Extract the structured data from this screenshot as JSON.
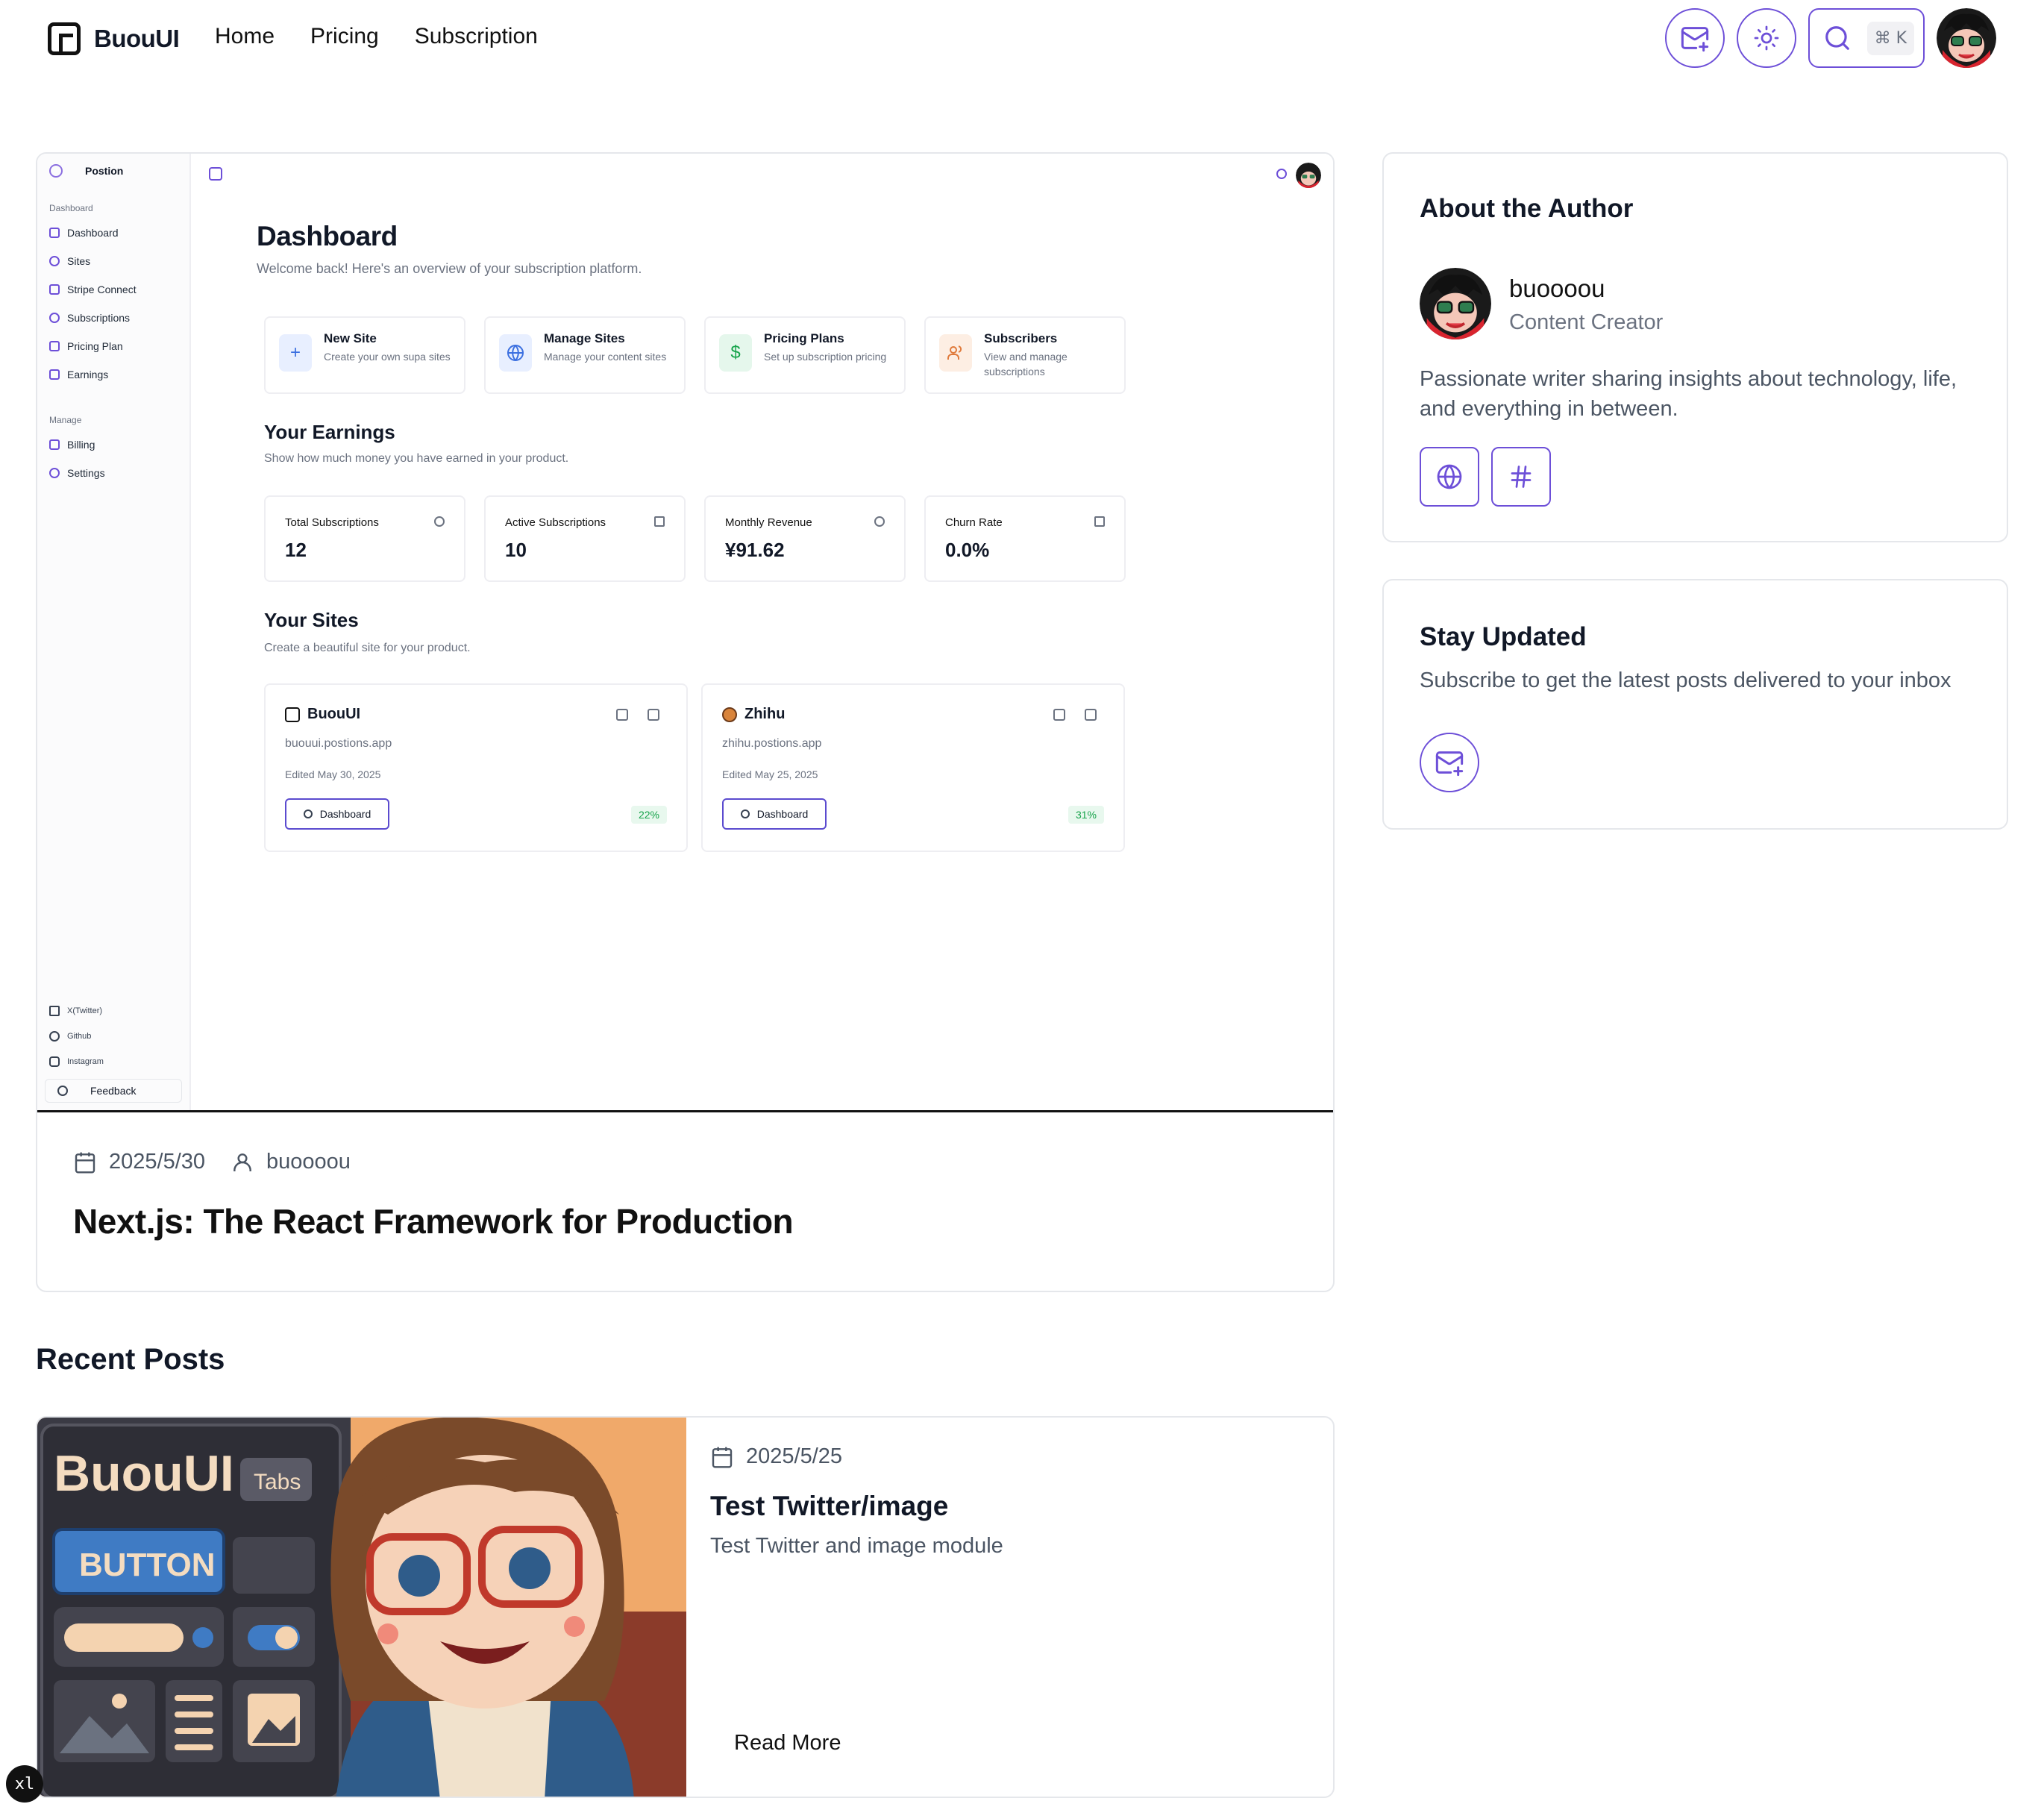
{
  "nav": {
    "brand": "BuouUI",
    "links": [
      "Home",
      "Pricing",
      "Subscription"
    ],
    "search_shortcut": "⌘ K",
    "icons": [
      "mail-plus-icon",
      "sun-icon",
      "search-icon"
    ]
  },
  "featured": {
    "dashboard": {
      "app_name": "Postion",
      "side_section_1": "Dashboard",
      "side_items_1": [
        "Dashboard",
        "Sites",
        "Stripe Connect",
        "Subscriptions",
        "Pricing Plan",
        "Earnings"
      ],
      "side_section_2": "Manage",
      "side_items_2": [
        "Billing",
        "Settings"
      ],
      "footer_links": [
        "X(Twitter)",
        "Github",
        "Instagram"
      ],
      "feedback": "Feedback",
      "title": "Dashboard",
      "subtitle": "Welcome back! Here's an overview of your subscription platform.",
      "quick_actions": [
        {
          "title": "New Site",
          "desc": "Create your own supa sites",
          "icon": "+"
        },
        {
          "title": "Manage Sites",
          "desc": "Manage your content sites",
          "icon": "globe"
        },
        {
          "title": "Pricing Plans",
          "desc": "Set up subscription pricing",
          "icon": "$"
        },
        {
          "title": "Subscribers",
          "desc": "View and manage subscriptions",
          "icon": "users"
        }
      ],
      "earnings_title": "Your Earnings",
      "earnings_sub": "Show how much money you have earned in your product.",
      "stats": [
        {
          "label": "Total Subscriptions",
          "value": "12"
        },
        {
          "label": "Active Subscriptions",
          "value": "10"
        },
        {
          "label": "Monthly Revenue",
          "value": "¥91.62"
        },
        {
          "label": "Churn Rate",
          "value": "0.0%"
        }
      ],
      "sites_title": "Your Sites",
      "sites_sub": "Create a beautiful site for your product.",
      "sites": [
        {
          "name": "BuouUI",
          "url": "buouui.postions.app",
          "edited": "Edited May 30, 2025",
          "button": "Dashboard",
          "pct": "22%"
        },
        {
          "name": "Zhihu",
          "url": "zhihu.postions.app",
          "edited": "Edited May 25, 2025",
          "button": "Dashboard",
          "pct": "31%"
        }
      ]
    },
    "date": "2025/5/30",
    "author": "buoooou",
    "title": "Next.js: The React Framework for Production"
  },
  "about": {
    "heading": "About the Author",
    "name": "buoooou",
    "role": "Content Creator",
    "bio": "Passionate writer sharing insights about technology, life, and everything in between."
  },
  "stay": {
    "heading": "Stay Updated",
    "text": "Subscribe to get the latest posts delivered to your inbox"
  },
  "recent": {
    "heading": "Recent Posts",
    "posts": [
      {
        "date": "2025/5/25",
        "title": "Test Twitter/image",
        "desc": "Test Twitter and image module",
        "read_more": "Read More",
        "image_text": {
          "brand": "BuouUI",
          "tab": "Tabs",
          "button": "BUTTON"
        }
      }
    ]
  },
  "badge": "xl",
  "colors": {
    "accent": "#6d4fd8",
    "border": "#e5e7eb",
    "muted": "#6b7280",
    "green": "#16a34a"
  }
}
